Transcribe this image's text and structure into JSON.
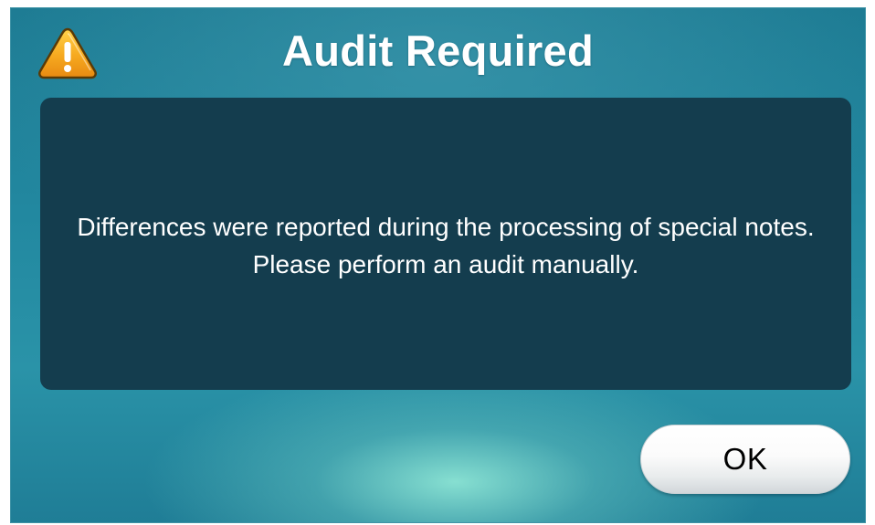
{
  "dialog": {
    "title": "Audit Required",
    "icon": "warning-icon",
    "message": "Differences were reported during the processing of special notes. Please perform an audit manually.",
    "ok_label": "OK"
  },
  "colors": {
    "background_teal": "#2288a0",
    "panel": "#143d4e",
    "warning_fill": "#f4a623",
    "text": "#ffffff"
  }
}
